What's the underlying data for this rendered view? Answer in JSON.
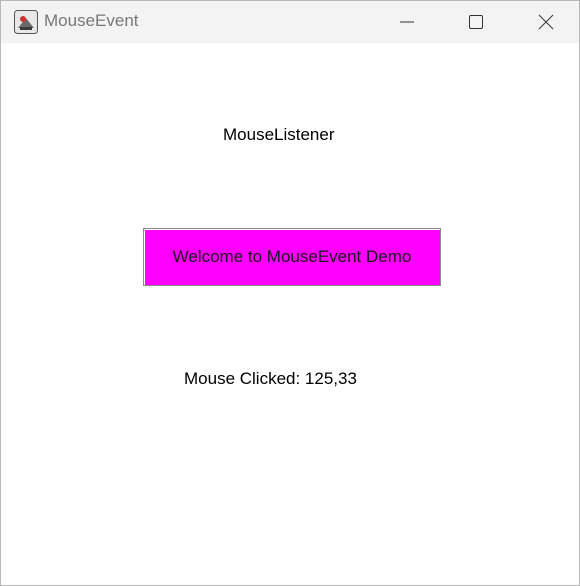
{
  "window": {
    "title": "MouseEvent",
    "icons": {
      "app": "java-app-icon",
      "minimize": "minimize-icon",
      "maximize": "maximize-icon",
      "close": "close-icon"
    }
  },
  "content": {
    "heading": "MouseListener",
    "button_label": "Welcome to MouseEvent Demo",
    "status": "Mouse Clicked: 125,33"
  },
  "colors": {
    "button_background": "#ff00ff",
    "titlebar_background": "#f3f3f3",
    "content_background": "#ffffff"
  }
}
